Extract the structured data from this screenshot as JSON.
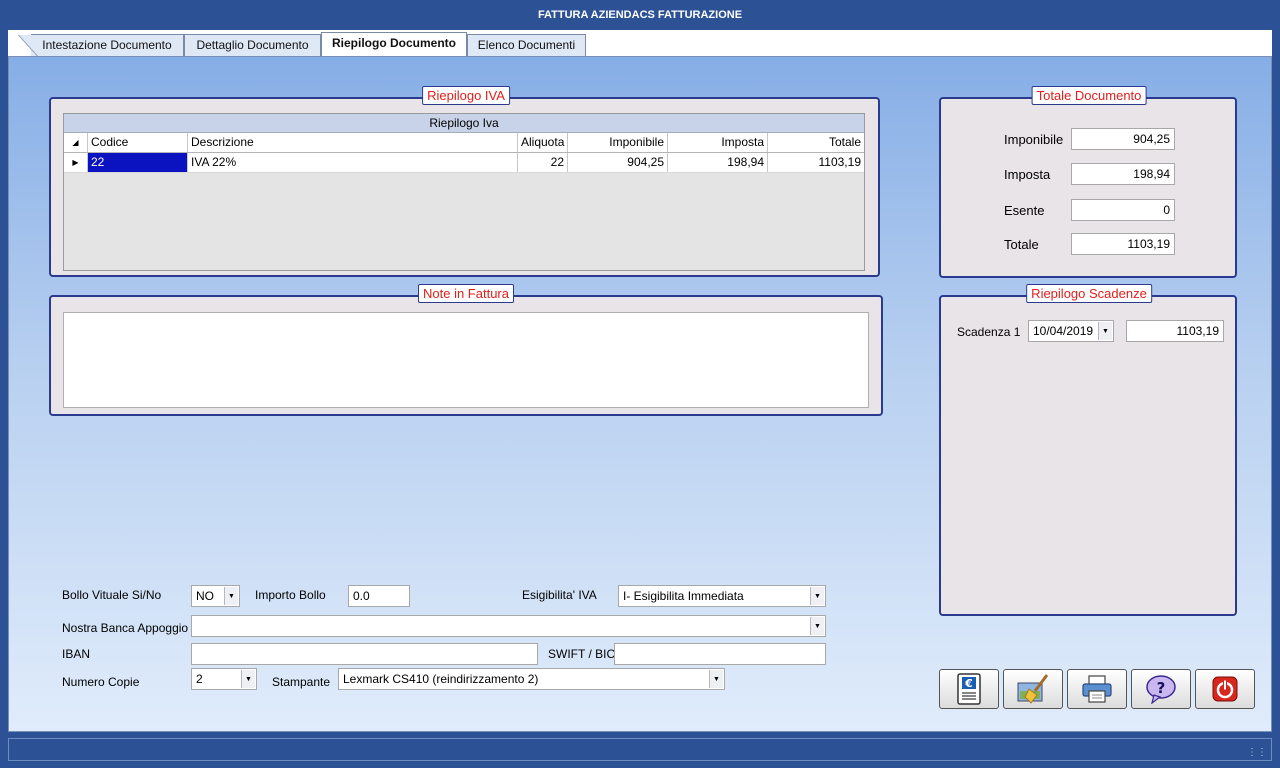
{
  "window": {
    "title": "FATTURA AZIENDACS FATTURAZIONE"
  },
  "tabs": [
    {
      "label": "Intestazione Documento"
    },
    {
      "label": "Dettaglio Documento"
    },
    {
      "label": "Riepilogo Documento"
    },
    {
      "label": "Elenco Documenti"
    }
  ],
  "iva_group": {
    "title": "Riepilogo IVA",
    "grid_caption": "Riepilogo Iva",
    "columns": [
      "Codice",
      "Descrizione",
      "Aliquota",
      "Imponibile",
      "Imposta",
      "Totale"
    ],
    "rows": [
      {
        "codice": "22",
        "descrizione": "IVA 22%",
        "aliquota": "22",
        "imponibile": "904,25",
        "imposta": "198,94",
        "totale": "1103,19"
      }
    ]
  },
  "note_group": {
    "title": "Note in Fattura",
    "text": ""
  },
  "totale_group": {
    "title": "Totale Documento",
    "imponibile_label": "Imponibile",
    "imponibile_value": "904,25",
    "imposta_label": "Imposta",
    "imposta_value": "198,94",
    "esente_label": "Esente",
    "esente_value": "0",
    "totale_label": "Totale",
    "totale_value": "1103,19"
  },
  "scadenze_group": {
    "title": "Riepilogo Scadenze",
    "scadenza_label": "Scadenza 1",
    "scadenza_date": "10/04/2019",
    "scadenza_amount": "1103,19"
  },
  "form": {
    "bollo_label": "Bollo Vituale Si/No",
    "bollo_value": "NO",
    "importo_bollo_label": "Importo Bollo",
    "importo_bollo_value": "0.0",
    "esigibilita_label": "Esigibilita' IVA",
    "esigibilita_value": "I- Esigibilita Immediata",
    "banca_label": "Nostra Banca Appoggio",
    "banca_value": "",
    "iban_label": "IBAN",
    "iban_value": "",
    "swift_label": "SWIFT / BIC",
    "swift_value": "",
    "copie_label": "Numero Copie",
    "copie_value": "2",
    "stampante_label": "Stampante",
    "stampante_value": "Lexmark CS410 (reindirizzamento 2)"
  },
  "buttons": [
    {
      "icon": "euro-document-icon"
    },
    {
      "icon": "broom-clear-icon"
    },
    {
      "icon": "printer-icon"
    },
    {
      "icon": "help-icon"
    },
    {
      "icon": "power-exit-icon"
    }
  ],
  "colors": {
    "titlebar": "#2c5295",
    "group_title_text": "#e0201c",
    "group_border": "#2a3b8f",
    "selected_cell": "#0b12c0"
  }
}
